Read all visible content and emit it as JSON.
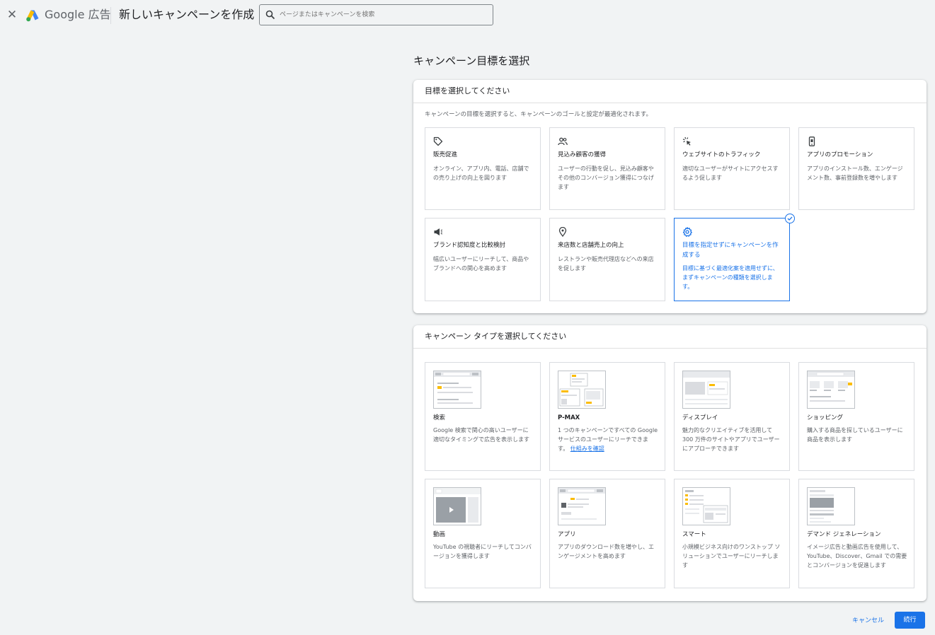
{
  "header": {
    "close_icon": "close-icon",
    "brand": "Google 広告",
    "page_title": "新しいキャンペーンを作成",
    "search_placeholder": "ページまたはキャンペーンを検索"
  },
  "section_title": "キャンペーン目標を選択",
  "goal_panel": {
    "title": "目標を選択してください",
    "description": "キャンペーンの目標を選択すると、キャンペーンのゴールと設定が最適化されます。",
    "goals": [
      {
        "icon": "tag-icon",
        "title": "販売促進",
        "desc": "オンライン、アプリ内、電話、店舗での売り上げの向上を図ります"
      },
      {
        "icon": "people-icon",
        "title": "見込み顧客の獲得",
        "desc": "ユーザーの行動を促し、見込み顧客やその他のコンバージョン獲得につなげます"
      },
      {
        "icon": "cursor-click-icon",
        "title": "ウェブサイトのトラフィック",
        "desc": "適切なユーザーがサイトにアクセスするよう促します"
      },
      {
        "icon": "phone-icon",
        "title": "アプリのプロモーション",
        "desc": "アプリのインストール数、エンゲージメント数、事前登録数を増やします"
      },
      {
        "icon": "megaphone-icon",
        "title": "ブランド認知度と比較検討",
        "desc": "幅広いユーザーにリーチして、商品やブランドへの関心を高めます"
      },
      {
        "icon": "location-pin-icon",
        "title": "来店数と店舗売上の向上",
        "desc": "レストランや販売代理店などへの来店を促します"
      },
      {
        "icon": "gear-icon",
        "title": "目標を指定せずにキャンペーンを作成する",
        "desc": "目標に基づく最適化案を適用せずに、まずキャンペーンの種類を選択します。",
        "selected": true
      }
    ]
  },
  "type_panel": {
    "title": "キャンペーン タイプを選択してください",
    "types": [
      {
        "title": "検索",
        "desc": "Google 検索で関心の高いユーザーに適切なタイミングで広告を表示します"
      },
      {
        "title": "P-MAX",
        "desc": "1 つのキャンペーンですべての Google サービスのユーザーにリーチできます。",
        "link": "仕組みを確認"
      },
      {
        "title": "ディスプレイ",
        "desc": "魅力的なクリエイティブを活用して 300 万件のサイトやアプリでユーザーにアプローチできます"
      },
      {
        "title": "ショッピング",
        "desc": "購入する商品を探しているユーザーに商品を表示します"
      },
      {
        "title": "動画",
        "desc": "YouTube の視聴者にリーチしてコンバージョンを獲得します"
      },
      {
        "title": "アプリ",
        "desc": "アプリのダウンロード数を増やし、エンゲージメントを高めます"
      },
      {
        "title": "スマート",
        "desc": "小規模ビジネス向けのワンストップ ソリューションでユーザーにリーチします"
      },
      {
        "title": "デマンド ジェネレーション",
        "desc": "イメージ広告と動画広告を使用して、YouTube、Discover、Gmail での需要とコンバージョンを促進します"
      }
    ]
  },
  "footer": {
    "cancel_label": "キャンセル",
    "continue_label": "続行"
  },
  "colors": {
    "accent": "#1a73e8",
    "background": "#f1f3f4"
  }
}
